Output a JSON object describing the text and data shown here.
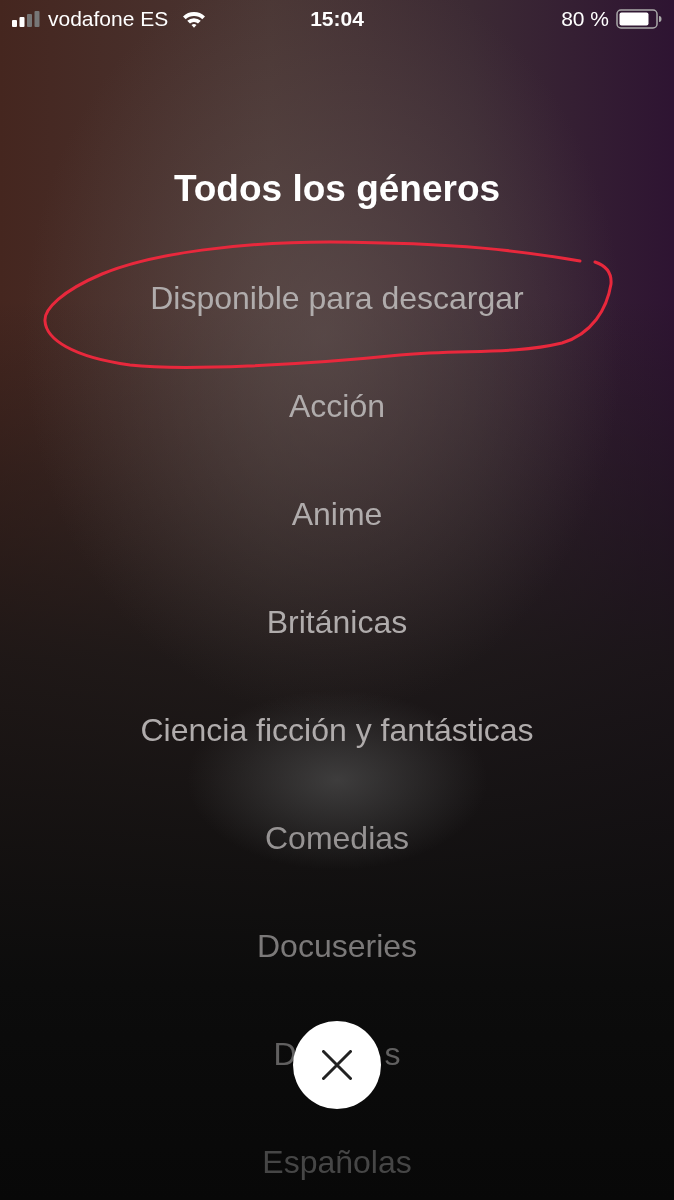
{
  "status_bar": {
    "carrier": "vodafone ES",
    "time": "15:04",
    "battery": "80 %"
  },
  "title": "Todos los géneros",
  "genres": [
    {
      "kind": "full",
      "label": "Disponible para descargar",
      "circled": true
    },
    {
      "kind": "full",
      "label": "Acción",
      "circled": false
    },
    {
      "kind": "full",
      "label": "Anime",
      "circled": false
    },
    {
      "kind": "full",
      "label": "Británicas",
      "circled": false
    },
    {
      "kind": "full",
      "label": "Ciencia ficción y fantásticas",
      "circled": false
    },
    {
      "kind": "full",
      "label": "Comedias",
      "circled": false
    },
    {
      "kind": "full",
      "label": "Docuseries",
      "circled": false
    },
    {
      "kind": "covered",
      "visible_parts": [
        "D",
        "s"
      ],
      "circled": false
    },
    {
      "kind": "full",
      "label": "Españolas",
      "circled": false
    }
  ]
}
